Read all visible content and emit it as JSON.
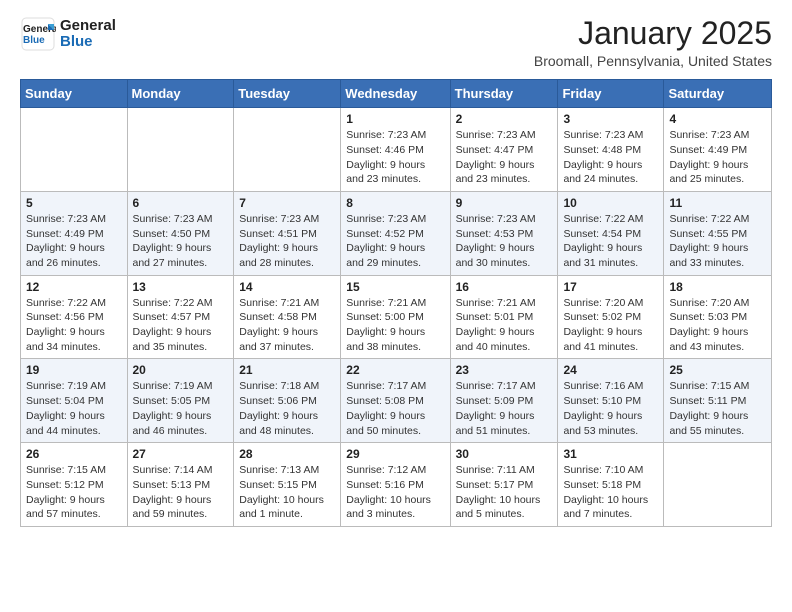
{
  "header": {
    "logo": {
      "general": "General",
      "blue": "Blue"
    },
    "month": "January 2025",
    "location": "Broomall, Pennsylvania, United States"
  },
  "weekdays": [
    "Sunday",
    "Monday",
    "Tuesday",
    "Wednesday",
    "Thursday",
    "Friday",
    "Saturday"
  ],
  "weeks": [
    [
      {
        "day": "",
        "info": ""
      },
      {
        "day": "",
        "info": ""
      },
      {
        "day": "",
        "info": ""
      },
      {
        "day": "1",
        "info": "Sunrise: 7:23 AM\nSunset: 4:46 PM\nDaylight: 9 hours and 23 minutes."
      },
      {
        "day": "2",
        "info": "Sunrise: 7:23 AM\nSunset: 4:47 PM\nDaylight: 9 hours and 23 minutes."
      },
      {
        "day": "3",
        "info": "Sunrise: 7:23 AM\nSunset: 4:48 PM\nDaylight: 9 hours and 24 minutes."
      },
      {
        "day": "4",
        "info": "Sunrise: 7:23 AM\nSunset: 4:49 PM\nDaylight: 9 hours and 25 minutes."
      }
    ],
    [
      {
        "day": "5",
        "info": "Sunrise: 7:23 AM\nSunset: 4:49 PM\nDaylight: 9 hours and 26 minutes."
      },
      {
        "day": "6",
        "info": "Sunrise: 7:23 AM\nSunset: 4:50 PM\nDaylight: 9 hours and 27 minutes."
      },
      {
        "day": "7",
        "info": "Sunrise: 7:23 AM\nSunset: 4:51 PM\nDaylight: 9 hours and 28 minutes."
      },
      {
        "day": "8",
        "info": "Sunrise: 7:23 AM\nSunset: 4:52 PM\nDaylight: 9 hours and 29 minutes."
      },
      {
        "day": "9",
        "info": "Sunrise: 7:23 AM\nSunset: 4:53 PM\nDaylight: 9 hours and 30 minutes."
      },
      {
        "day": "10",
        "info": "Sunrise: 7:22 AM\nSunset: 4:54 PM\nDaylight: 9 hours and 31 minutes."
      },
      {
        "day": "11",
        "info": "Sunrise: 7:22 AM\nSunset: 4:55 PM\nDaylight: 9 hours and 33 minutes."
      }
    ],
    [
      {
        "day": "12",
        "info": "Sunrise: 7:22 AM\nSunset: 4:56 PM\nDaylight: 9 hours and 34 minutes."
      },
      {
        "day": "13",
        "info": "Sunrise: 7:22 AM\nSunset: 4:57 PM\nDaylight: 9 hours and 35 minutes."
      },
      {
        "day": "14",
        "info": "Sunrise: 7:21 AM\nSunset: 4:58 PM\nDaylight: 9 hours and 37 minutes."
      },
      {
        "day": "15",
        "info": "Sunrise: 7:21 AM\nSunset: 5:00 PM\nDaylight: 9 hours and 38 minutes."
      },
      {
        "day": "16",
        "info": "Sunrise: 7:21 AM\nSunset: 5:01 PM\nDaylight: 9 hours and 40 minutes."
      },
      {
        "day": "17",
        "info": "Sunrise: 7:20 AM\nSunset: 5:02 PM\nDaylight: 9 hours and 41 minutes."
      },
      {
        "day": "18",
        "info": "Sunrise: 7:20 AM\nSunset: 5:03 PM\nDaylight: 9 hours and 43 minutes."
      }
    ],
    [
      {
        "day": "19",
        "info": "Sunrise: 7:19 AM\nSunset: 5:04 PM\nDaylight: 9 hours and 44 minutes."
      },
      {
        "day": "20",
        "info": "Sunrise: 7:19 AM\nSunset: 5:05 PM\nDaylight: 9 hours and 46 minutes."
      },
      {
        "day": "21",
        "info": "Sunrise: 7:18 AM\nSunset: 5:06 PM\nDaylight: 9 hours and 48 minutes."
      },
      {
        "day": "22",
        "info": "Sunrise: 7:17 AM\nSunset: 5:08 PM\nDaylight: 9 hours and 50 minutes."
      },
      {
        "day": "23",
        "info": "Sunrise: 7:17 AM\nSunset: 5:09 PM\nDaylight: 9 hours and 51 minutes."
      },
      {
        "day": "24",
        "info": "Sunrise: 7:16 AM\nSunset: 5:10 PM\nDaylight: 9 hours and 53 minutes."
      },
      {
        "day": "25",
        "info": "Sunrise: 7:15 AM\nSunset: 5:11 PM\nDaylight: 9 hours and 55 minutes."
      }
    ],
    [
      {
        "day": "26",
        "info": "Sunrise: 7:15 AM\nSunset: 5:12 PM\nDaylight: 9 hours and 57 minutes."
      },
      {
        "day": "27",
        "info": "Sunrise: 7:14 AM\nSunset: 5:13 PM\nDaylight: 9 hours and 59 minutes."
      },
      {
        "day": "28",
        "info": "Sunrise: 7:13 AM\nSunset: 5:15 PM\nDaylight: 10 hours and 1 minute."
      },
      {
        "day": "29",
        "info": "Sunrise: 7:12 AM\nSunset: 5:16 PM\nDaylight: 10 hours and 3 minutes."
      },
      {
        "day": "30",
        "info": "Sunrise: 7:11 AM\nSunset: 5:17 PM\nDaylight: 10 hours and 5 minutes."
      },
      {
        "day": "31",
        "info": "Sunrise: 7:10 AM\nSunset: 5:18 PM\nDaylight: 10 hours and 7 minutes."
      },
      {
        "day": "",
        "info": ""
      }
    ]
  ]
}
